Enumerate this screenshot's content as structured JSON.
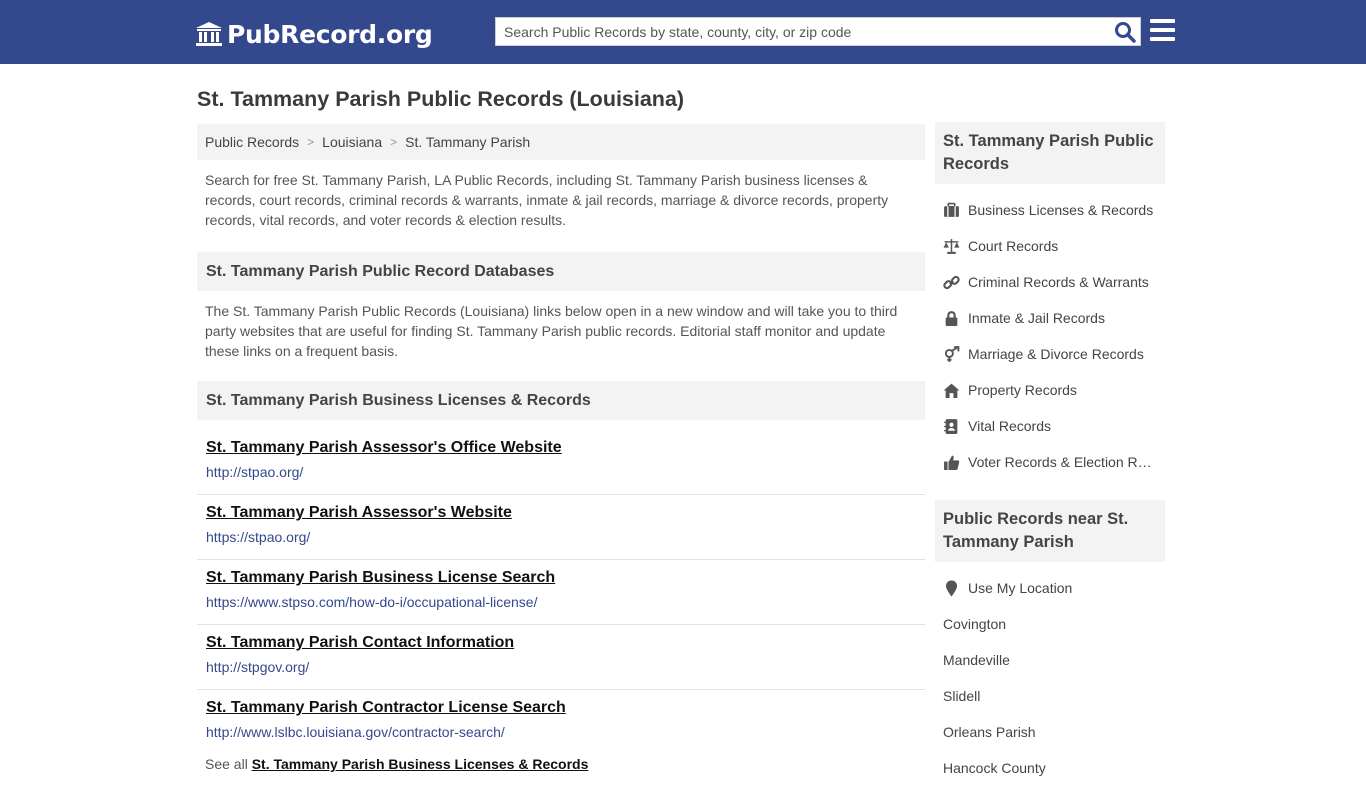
{
  "header": {
    "logo_text": "PubRecord.org",
    "search_placeholder": "Search Public Records by state, county, city, or zip code"
  },
  "page_title": "St. Tammany Parish Public Records (Louisiana)",
  "breadcrumb": [
    "Public Records",
    "Louisiana",
    "St. Tammany Parish"
  ],
  "intro": "Search for free St. Tammany Parish, LA Public Records, including St. Tammany Parish business licenses & records, court records, criminal records & warrants, inmate & jail records, marriage & divorce records, property records, vital records, and voter records & election results.",
  "databases": {
    "heading": "St. Tammany Parish Public Record Databases",
    "text": "The St. Tammany Parish Public Records (Louisiana) links below open in a new window and will take you to third party websites that are useful for finding St. Tammany Parish public records. Editorial staff monitor and update these links on a frequent basis."
  },
  "business": {
    "heading": "St. Tammany Parish Business Licenses & Records",
    "links": [
      {
        "title": "St. Tammany Parish Assessor's Office Website",
        "url": "http://stpao.org/"
      },
      {
        "title": "St. Tammany Parish Assessor's Website",
        "url": "https://stpao.org/"
      },
      {
        "title": "St. Tammany Parish Business License Search",
        "url": "https://www.stpso.com/how-do-i/occupational-license/"
      },
      {
        "title": "St. Tammany Parish Contact Information",
        "url": "http://stpgov.org/"
      },
      {
        "title": "St. Tammany Parish Contractor License Search",
        "url": "http://www.lslbc.louisiana.gov/contractor-search/"
      }
    ],
    "see_all_prefix": "See all",
    "see_all_link": "St. Tammany Parish Business Licenses & Records"
  },
  "sidebar": {
    "heading": "St. Tammany Parish Public Records",
    "items": [
      {
        "label": "Business Licenses & Records",
        "icon": "briefcase-icon"
      },
      {
        "label": "Court Records",
        "icon": "scale-icon"
      },
      {
        "label": "Criminal Records & Warrants",
        "icon": "link-icon"
      },
      {
        "label": "Inmate & Jail Records",
        "icon": "lock-icon"
      },
      {
        "label": "Marriage & Divorce Records",
        "icon": "venus-mars-icon"
      },
      {
        "label": "Property Records",
        "icon": "home-icon"
      },
      {
        "label": "Vital Records",
        "icon": "address-book-icon"
      },
      {
        "label": "Voter Records & Election Results",
        "icon": "thumbs-up-icon"
      }
    ],
    "near_heading": "Public Records near St. Tammany Parish",
    "use_location": "Use My Location",
    "near": [
      "Covington",
      "Mandeville",
      "Slidell",
      "Orleans Parish",
      "Hancock County"
    ]
  }
}
